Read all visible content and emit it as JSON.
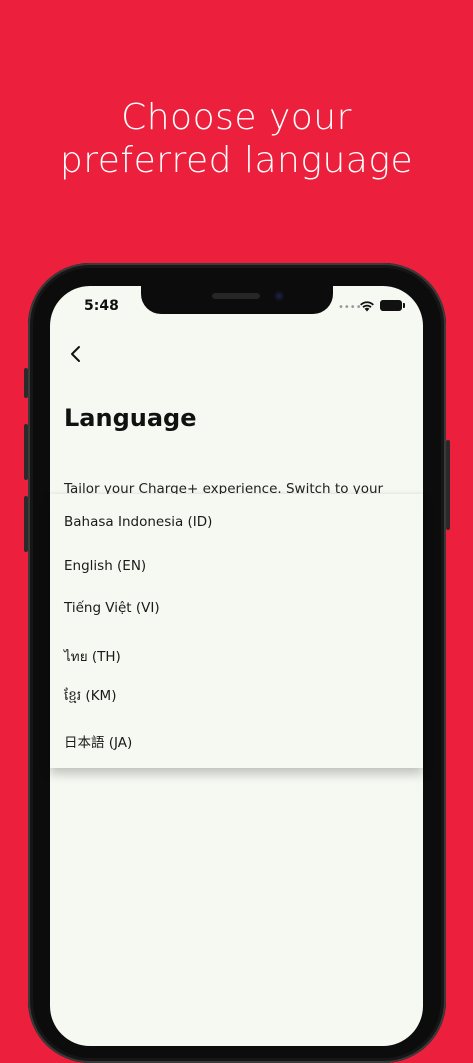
{
  "headline": {
    "line1": "Choose your",
    "line2": "preferred language"
  },
  "status_bar": {
    "time": "5:48",
    "dots": "••••"
  },
  "page": {
    "title": "Language",
    "description": "Tailor your Charge+ experience. Switch to your"
  },
  "language_menu": {
    "options": [
      "Bahasa Indonesia (ID)",
      "English (EN)",
      "Tiếng Việt (VI)",
      "ไทย (TH)",
      "ខ្មែរ (KM)",
      "日本語 (JA)"
    ]
  },
  "colors": {
    "background": "#ec1f3c",
    "screen": "#f6f9f2",
    "text": "#111111"
  },
  "icons": [
    "back-icon",
    "wifi-icon",
    "battery-icon"
  ]
}
